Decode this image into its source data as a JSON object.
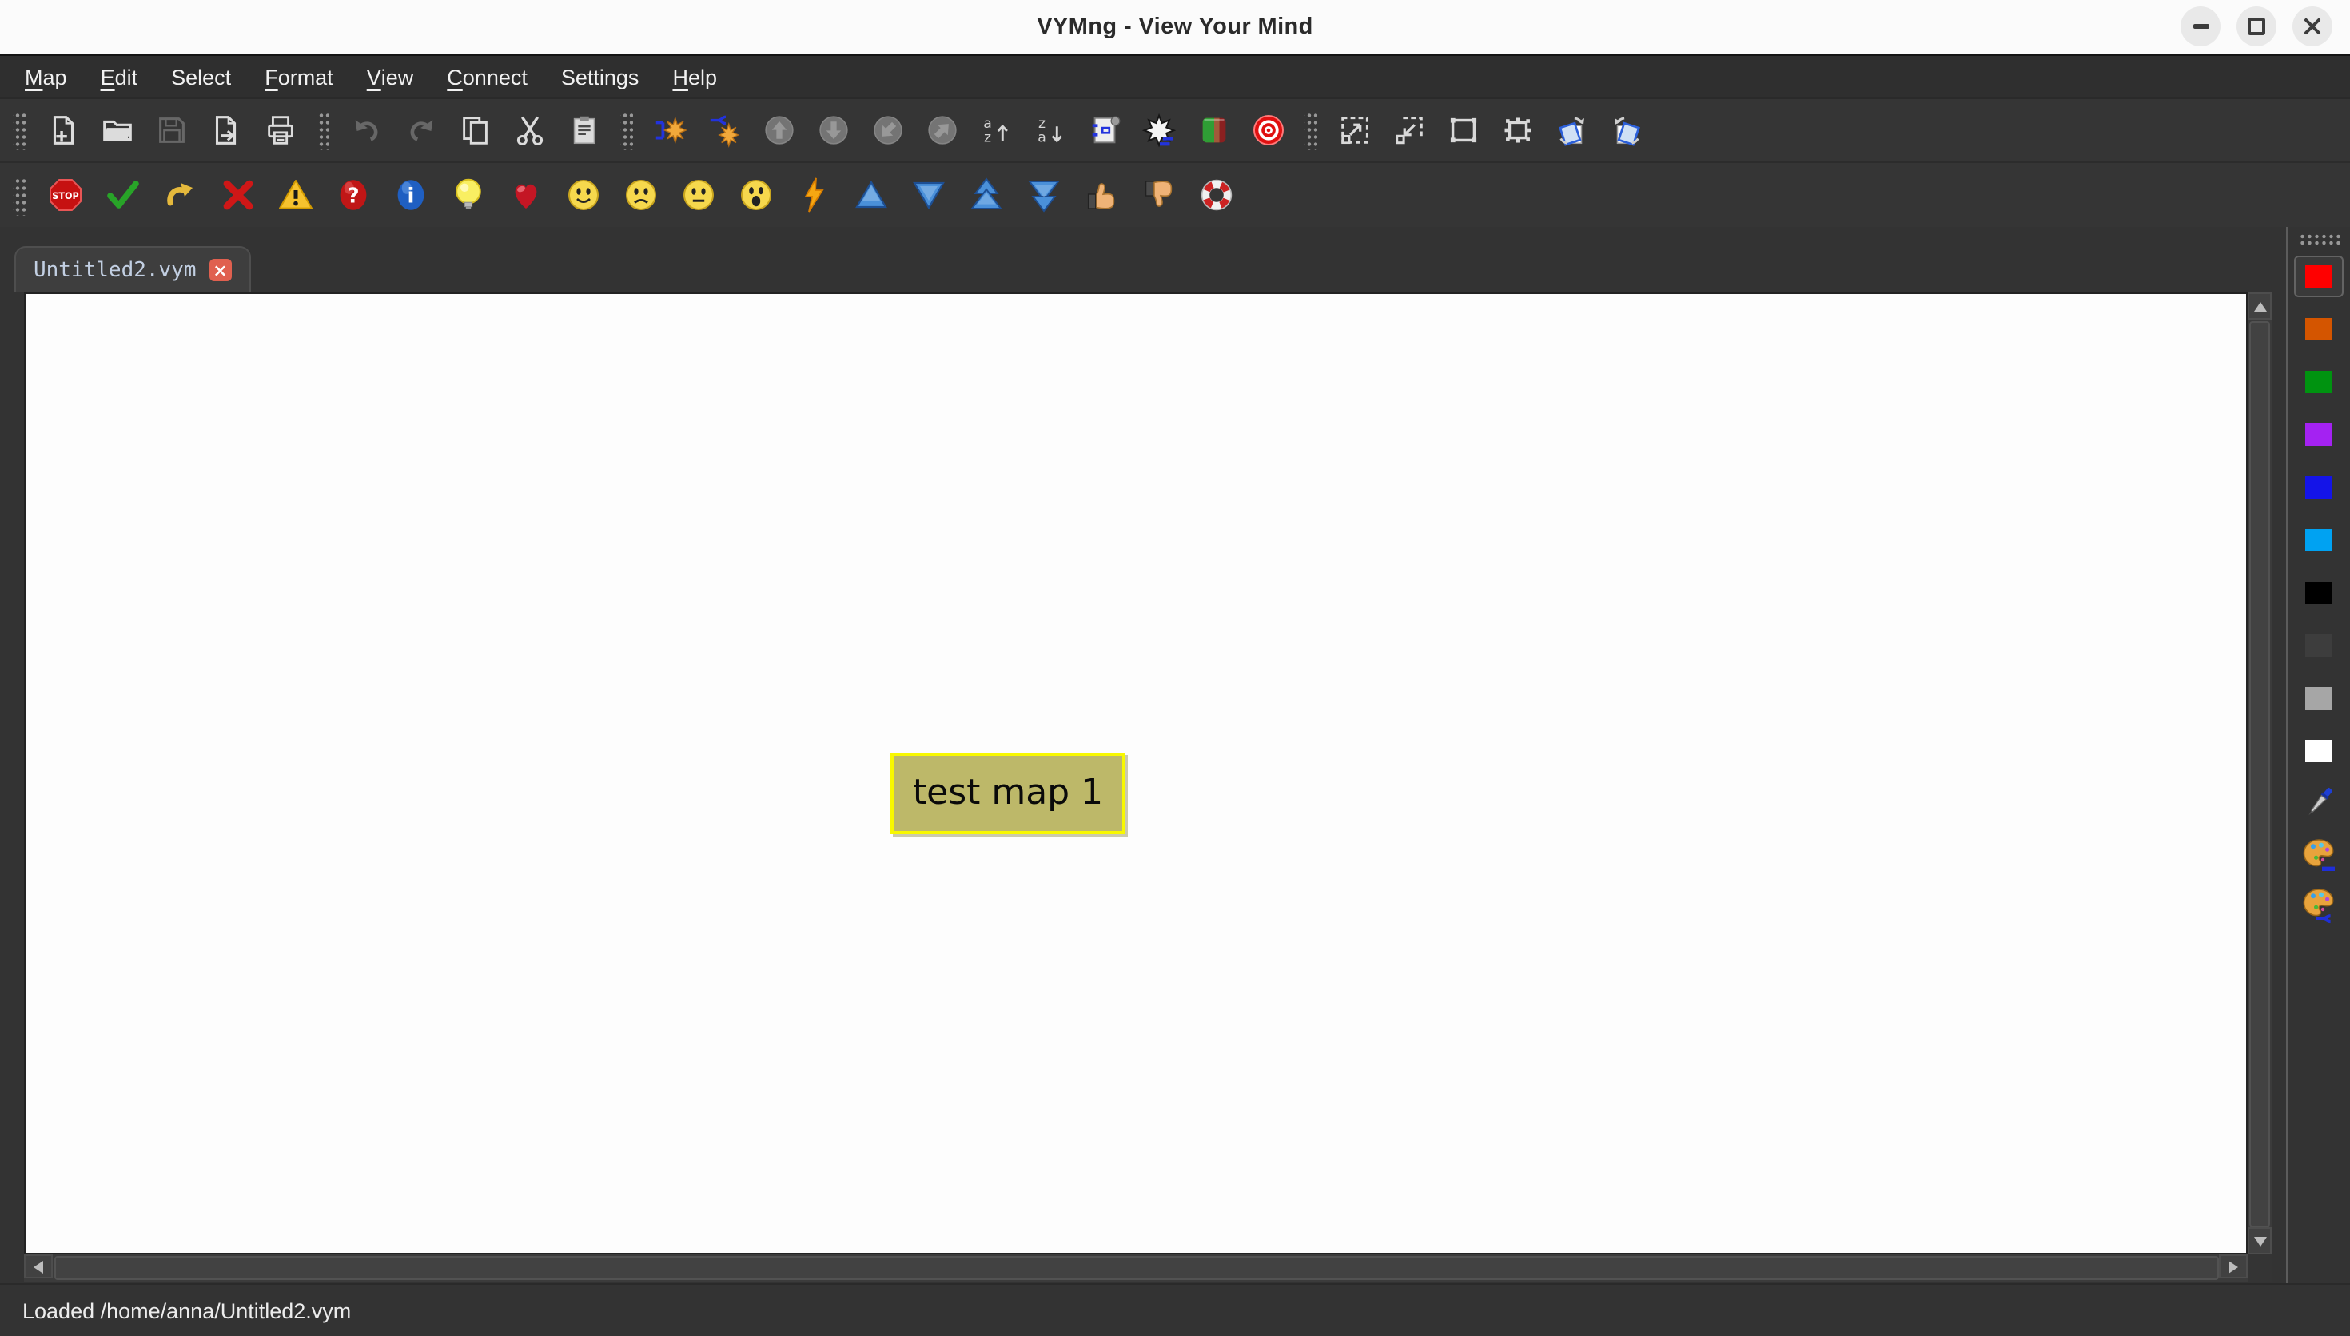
{
  "window": {
    "title": "VYMng - View Your Mind",
    "controls": [
      "minimize",
      "restore",
      "close"
    ]
  },
  "menubar": {
    "items": [
      {
        "pre": "",
        "key": "M",
        "post": "ap"
      },
      {
        "pre": "",
        "key": "E",
        "post": "dit"
      },
      {
        "pre": "Select",
        "key": "",
        "post": ""
      },
      {
        "pre": "",
        "key": "F",
        "post": "ormat"
      },
      {
        "pre": "",
        "key": "V",
        "post": "iew"
      },
      {
        "pre": "",
        "key": "C",
        "post": "onnect"
      },
      {
        "pre": "Settings",
        "key": "",
        "post": ""
      },
      {
        "pre": "",
        "key": "H",
        "post": "elp"
      }
    ]
  },
  "toolbar_map": {
    "icons": [
      "drag-handle",
      "new-map",
      "open-map",
      "save-map",
      "export-map",
      "print-map",
      "drag-handle",
      "undo",
      "redo",
      "copy",
      "cut",
      "paste",
      "drag-handle",
      "add-branch",
      "add-branch-before",
      "move-branch-up",
      "move-branch-down",
      "move-branch-in",
      "move-branch-out",
      "sort-ascending",
      "sort-descending",
      "scroll-branch",
      "unscroll-children",
      "toggle-standard-flags",
      "toggle-target",
      "drag-handle",
      "zoom-in",
      "zoom-out",
      "zoom-reset",
      "center-on-selection",
      "rotate-counterclockwise",
      "rotate-clockwise"
    ],
    "disabled": [
      "save-map",
      "undo",
      "redo",
      "move-branch-up",
      "move-branch-down",
      "move-branch-in",
      "move-branch-out"
    ],
    "sort_asc": {
      "top": "a",
      "bottom": "z",
      "arrow": "↑"
    },
    "sort_desc": {
      "top": "z",
      "bottom": "a",
      "arrow": "↓"
    }
  },
  "toolbar_flags": {
    "icons": [
      "drag-handle",
      "stopsign-flag",
      "ok-flag",
      "hook-flag",
      "cross-flag",
      "warning-flag",
      "question-flag",
      "info-flag",
      "lamp-flag",
      "heart-flag",
      "smiley-good-flag",
      "smiley-sad-flag",
      "smiley-neutral-flag",
      "smiley-omg-flag",
      "flash-flag",
      "arrow-up-flag",
      "arrow-down-flag",
      "arrow-2up-flag",
      "arrow-2down-flag",
      "thumb-up-flag",
      "thumb-down-flag",
      "lifebelt-flag"
    ],
    "stop_label": "STOP",
    "question_glyph": "?",
    "info_glyph": "i"
  },
  "tabbar": {
    "tabs": [
      {
        "label": "Untitled2.vym",
        "close_glyph": "×"
      }
    ]
  },
  "map_view": {
    "nodes": [
      {
        "label": "test map 1",
        "bg": "#bdb869",
        "border": "#f8f800"
      }
    ]
  },
  "sidebar": {
    "colors": [
      "#ff0000",
      "#d45500",
      "#009310",
      "#a422f2",
      "#1414e8",
      "#00a2f2",
      "#000000",
      "#3d3d3d",
      "#a6a6a6",
      "#ffffff"
    ],
    "selected_index": 0,
    "tools": [
      "pick-color",
      "color-branch",
      "color-subtree"
    ]
  },
  "statusbar": {
    "message": "Loaded /home/anna/Untitled2.vym"
  },
  "theme": {
    "titlebar_bg": "#fbfbfb",
    "chrome_bg": "#353535",
    "menubar_bg": "#2f2f2f",
    "tab_bg": "#3e3e3e",
    "tab_text": "#c2cfe2",
    "close_button": "#e0604f",
    "canvas_bg": "#fdfdfd",
    "status_text": "#ececec"
  }
}
